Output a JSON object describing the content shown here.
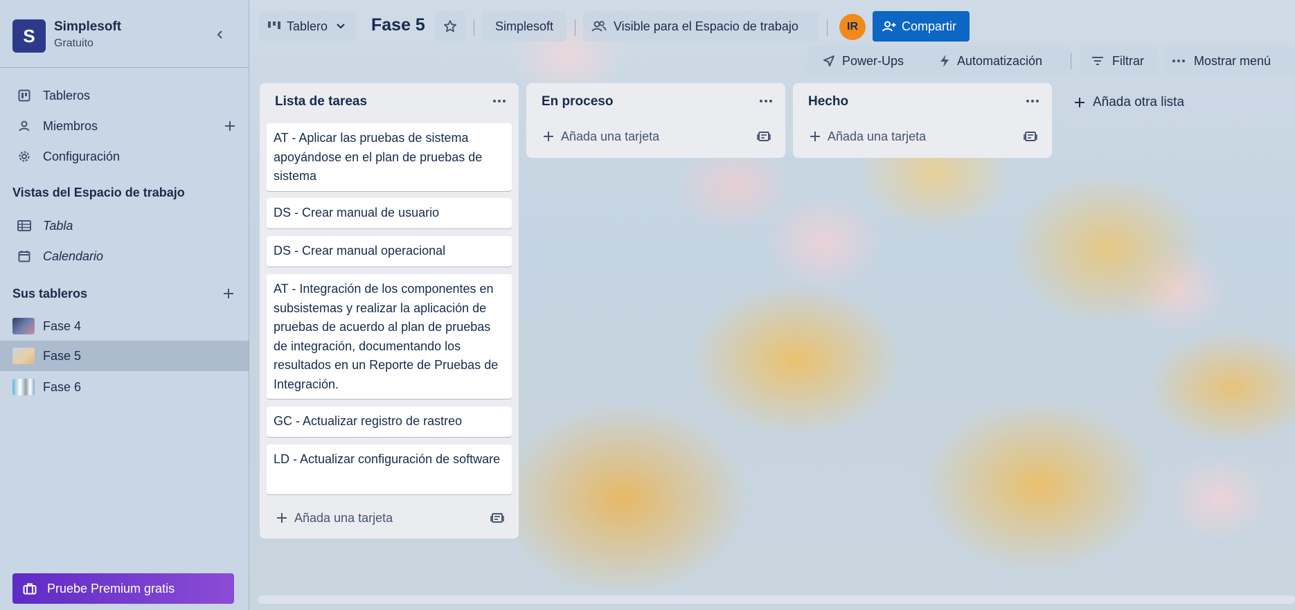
{
  "workspace": {
    "initial": "S",
    "name": "Simplesoft",
    "plan": "Gratuito"
  },
  "sidebar": {
    "nav": [
      {
        "label": "Tableros",
        "icon": "board-icon"
      },
      {
        "label": "Miembros",
        "icon": "person-icon"
      },
      {
        "label": "Configuración",
        "icon": "gear-icon"
      }
    ],
    "views_title": "Vistas del Espacio de trabajo",
    "views": [
      {
        "label": "Tabla",
        "icon": "table-icon"
      },
      {
        "label": "Calendario",
        "icon": "calendar-icon"
      }
    ],
    "boards_title": "Sus tableros",
    "boards": [
      {
        "label": "Fase 4"
      },
      {
        "label": "Fase 5"
      },
      {
        "label": "Fase 6"
      }
    ],
    "premium_label": "Pruebe Premium gratis"
  },
  "header": {
    "view_switcher": "Tablero",
    "board_title": "Fase 5",
    "workspace_button": "Simplesoft",
    "visibility": "Visible para el Espacio de trabajo",
    "avatar_initials": "IR",
    "share": "Compartir",
    "power_ups": "Power-Ups",
    "automation": "Automatización",
    "filter": "Filtrar",
    "show_menu": "Mostrar menú"
  },
  "lists": [
    {
      "title": "Lista de tareas",
      "cards": [
        "AT - Aplicar las pruebas de sistema apoyándose en el plan de pruebas de sistema",
        "DS - Crear manual de usuario",
        "DS - Crear manual operacional",
        "AT - Integración de los componentes en subsistemas y realizar la aplicación de pruebas de acuerdo al plan de pruebas de integración, documentando los resultados en un Reporte de Pruebas de Integración.",
        "GC - Actualizar registro de rastreo",
        "LD - Actualizar configuración de software"
      ],
      "add_card": "Añada una tarjeta"
    },
    {
      "title": "En proceso",
      "cards": [],
      "add_card": "Añada una tarjeta"
    },
    {
      "title": "Hecho",
      "cards": [],
      "add_card": "Añada una tarjeta"
    }
  ],
  "add_list": "Añada otra lista",
  "colors": {
    "accent": "#0c66c4",
    "workspace_logo": "#2d3a8c",
    "avatar": "#f08a1c",
    "premium": "#7b3fd0"
  }
}
